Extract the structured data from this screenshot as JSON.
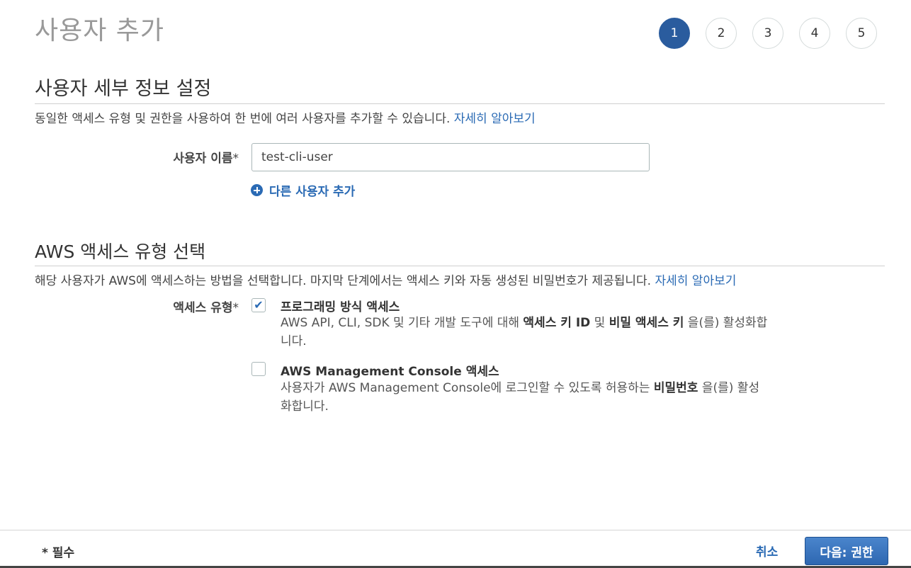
{
  "page": {
    "title": "사용자 추가",
    "steps": [
      "1",
      "2",
      "3",
      "4",
      "5"
    ],
    "active_step": 1
  },
  "details": {
    "heading": "사용자 세부 정보 설정",
    "description": "동일한 액세스 유형 및 권한을 사용하여 한 번에 여러 사용자를 추가할 수 있습니다. ",
    "learn_more": "자세히 알아보기",
    "username_label": "사용자 이름",
    "required_mark": "*",
    "username_value": "test-cli-user",
    "add_user_link": "다른 사용자 추가"
  },
  "access": {
    "heading": "AWS 액세스 유형 선택",
    "description": "해당 사용자가 AWS에 액세스하는 방법을 선택합니다. 마지막 단계에서는 액세스 키와 자동 생성된 비밀번호가 제공됩니다. ",
    "learn_more": "자세히 알아보기",
    "type_label": "액세스 유형",
    "options": [
      {
        "title": "프로그래밍 방식 액세스",
        "checked": true,
        "desc_pre": "AWS API, CLI, SDK 및 기타 개발 도구에 대해 ",
        "desc_bold1": "액세스 키 ID",
        "desc_mid": " 및 ",
        "desc_bold2": "비밀 액세스 키",
        "desc_post": " 을(를) 활성화합니다."
      },
      {
        "title": "AWS Management Console 액세스",
        "checked": false,
        "desc_pre": "사용자가 AWS Management Console에 로그인할 수 있도록 허용하는 ",
        "desc_bold1": "비밀번호",
        "desc_post": " 을(를) 활성화합니다."
      }
    ]
  },
  "footer": {
    "required_note": "* 필수",
    "cancel": "취소",
    "next": "다음: 권한"
  },
  "colors": {
    "accent": "#2a5c9e",
    "link": "#2a6ab4",
    "title_gray": "#999999"
  },
  "icons": {
    "add_user": "plus-circle-icon",
    "checked": "checkmark-icon"
  }
}
